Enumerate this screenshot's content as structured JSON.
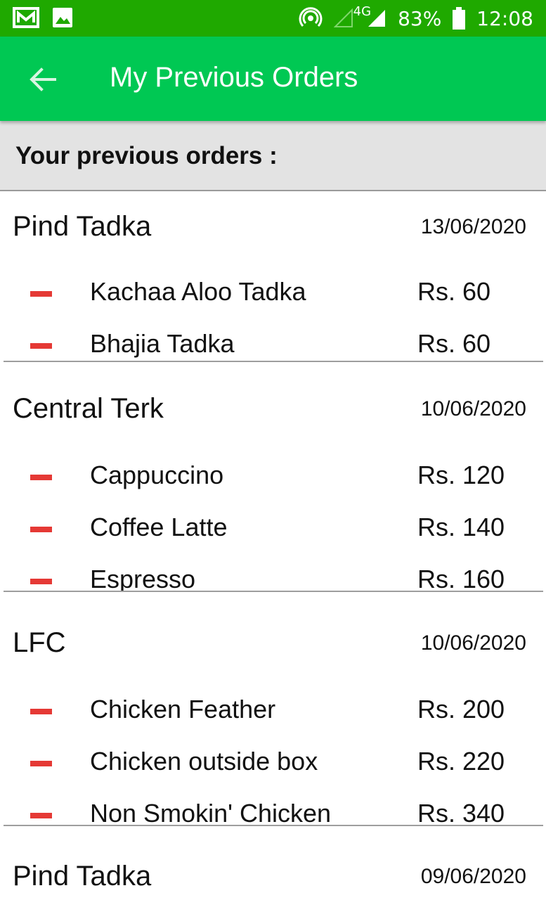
{
  "status_bar": {
    "icons_left": [
      "mail-icon",
      "image-icon"
    ],
    "network": "4G",
    "battery": "83%",
    "time": "12:08"
  },
  "app_bar": {
    "back_icon": "arrow-left-icon",
    "title": "My Previous Orders"
  },
  "subheader": "Your previous orders :",
  "orders": [
    {
      "restaurant": "Pind Tadka",
      "date": "13/06/2020",
      "items": [
        {
          "name": "Kachaa Aloo Tadka",
          "price": "Rs. 60"
        },
        {
          "name": "Bhajia Tadka",
          "price": "Rs. 60"
        }
      ]
    },
    {
      "restaurant": "Central Terk",
      "date": "10/06/2020",
      "items": [
        {
          "name": "Cappuccino",
          "price": "Rs. 120"
        },
        {
          "name": "Coffee Latte",
          "price": "Rs. 140"
        },
        {
          "name": "Espresso",
          "price": "Rs. 160"
        }
      ]
    },
    {
      "restaurant": "LFC",
      "date": "10/06/2020",
      "items": [
        {
          "name": "Chicken Feather",
          "price": "Rs. 200"
        },
        {
          "name": "Chicken outside box",
          "price": "Rs. 220"
        },
        {
          "name": "Non Smokin' Chicken",
          "price": "Rs. 340"
        }
      ]
    },
    {
      "restaurant": "Pind Tadka",
      "date": "09/06/2020",
      "items": []
    }
  ],
  "colors": {
    "status_bar": "#1fa900",
    "app_bar": "#00c853",
    "subheader_bg": "#e3e3e3",
    "item_marker": "#e53935"
  }
}
